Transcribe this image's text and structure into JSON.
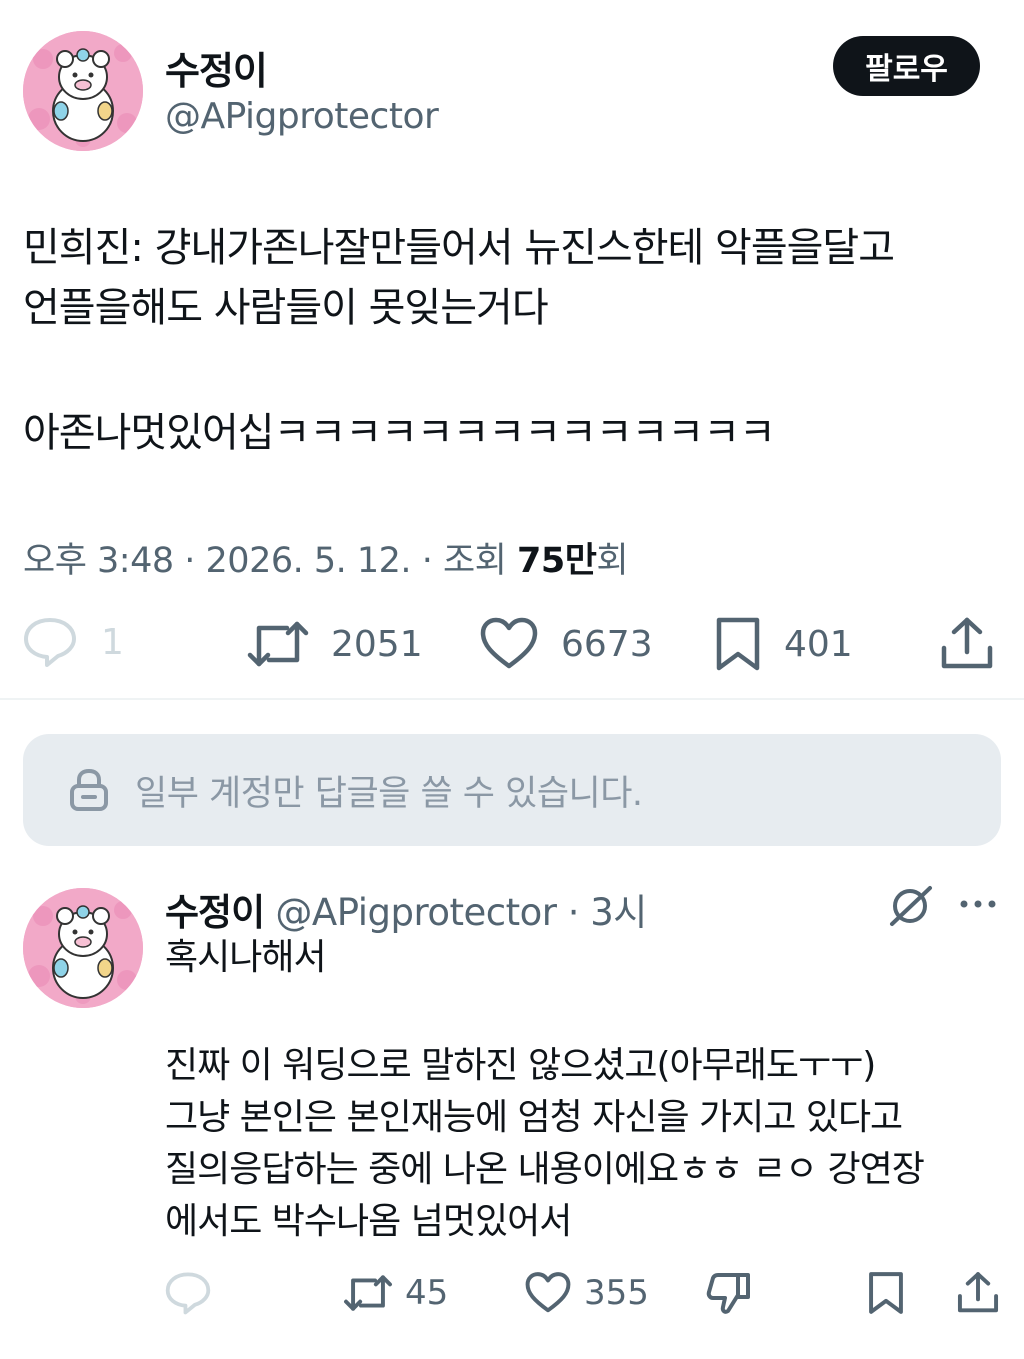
{
  "main_tweet": {
    "author_name": "수정이",
    "author_handle": "@APigprotector",
    "follow_label": "팔로우",
    "text_lines": [
      "민희진: 걍내가존나잘만들어서 뉴진스한테 악플을달고",
      "언플을해도 사람들이 못잊는거다",
      "아존나멋있어십ㅋㅋㅋㅋㅋㅋㅋㅋㅋㅋㅋㅋㅋㅋ"
    ],
    "time": "오후 3:48",
    "date": "2026. 5. 12.",
    "views_label": "조회",
    "views_number": "75만",
    "views_suffix": "회",
    "counts": {
      "replies": "1",
      "retweets": "2051",
      "likes": "6673",
      "bookmarks": "401"
    }
  },
  "reply_restriction": {
    "text": "일부 계정만 답글을 쓸 수 있습니다."
  },
  "reply_tweet": {
    "author_name": "수정이",
    "author_handle": "@APigprotector",
    "time_ago": "3시",
    "text_lines": [
      "혹시나해서",
      "진짜 이 워딩으로 말하진 않으셨고(아무래도ㅜㅜ)",
      "그냥 본인은 본인재능에 엄청 자신을 가지고 있다고",
      "질의응답하는 중에 나온 내용이에요ㅎㅎ ㄹㅇ 강연장",
      "에서도 박수나옴 넘멋있어서"
    ],
    "counts": {
      "retweets": "45",
      "likes": "355"
    }
  },
  "icons": {
    "reply": "speech-bubble-icon",
    "retweet": "retweet-icon",
    "like": "heart-icon",
    "bookmark": "bookmark-icon",
    "share": "share-icon",
    "lock": "lock-icon",
    "grok": "grok-icon",
    "more": "more-dots-icon",
    "dislike": "dislike-icon"
  },
  "colors": {
    "text": "#0f1419",
    "secondary": "#536471",
    "follow_bg": "#0f1419",
    "restrict_bg": "#e7ecf0",
    "avatar_bg": "#f0a8c8"
  }
}
